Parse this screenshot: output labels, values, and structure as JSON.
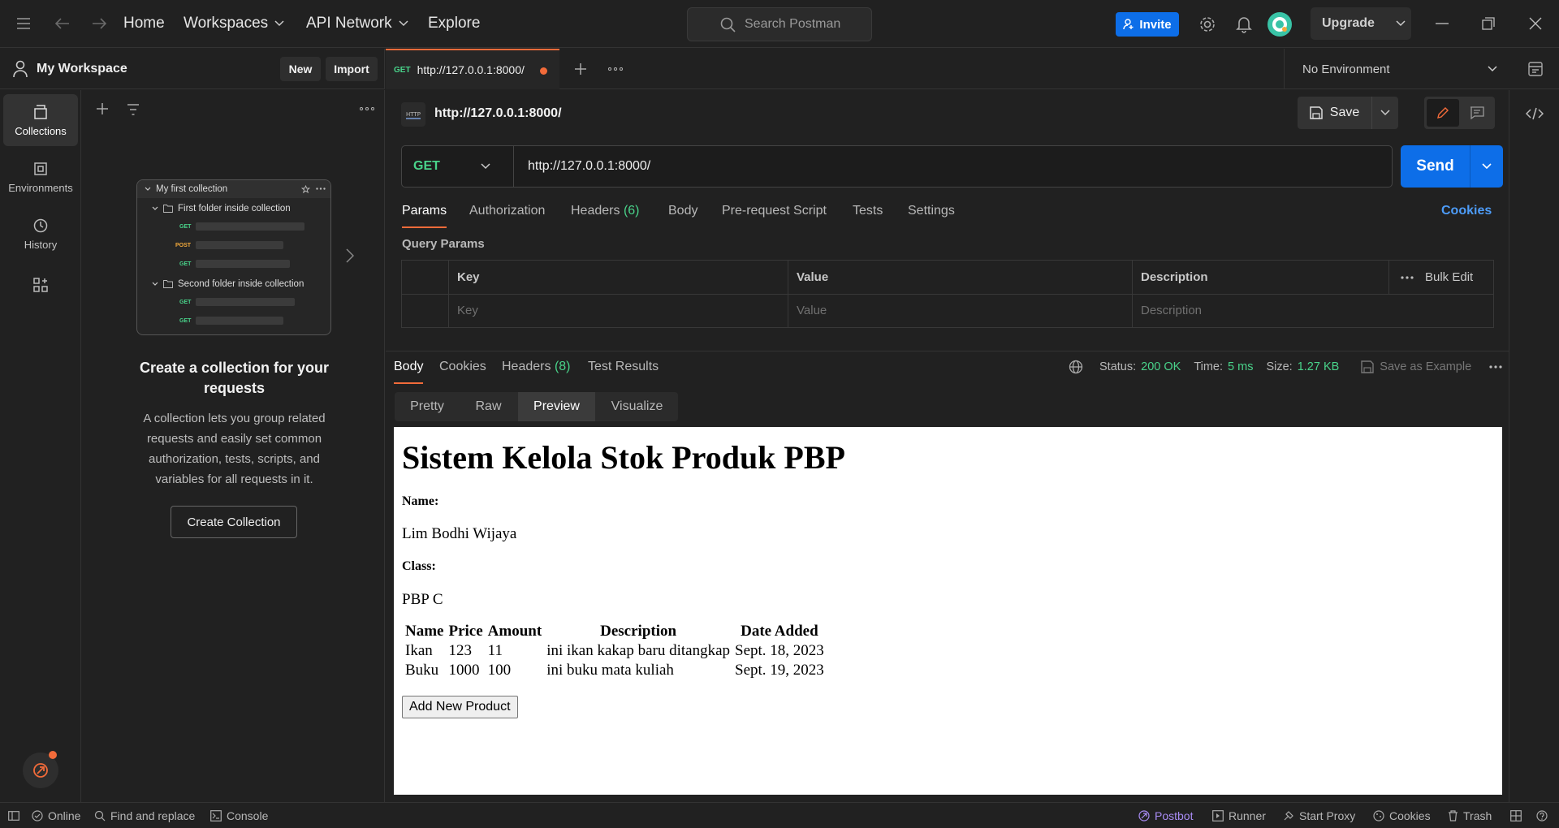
{
  "topbar": {
    "nav": [
      "Home",
      "Workspaces",
      "API Network",
      "Explore"
    ],
    "search_placeholder": "Search Postman",
    "invite_label": "Invite",
    "upgrade_label": "Upgrade"
  },
  "sidebar": {
    "workspace_name": "My Workspace",
    "new_label": "New",
    "import_label": "Import",
    "rail": [
      {
        "label": "Collections",
        "icon": "collections-icon",
        "active": true
      },
      {
        "label": "Environments",
        "icon": "environments-icon",
        "active": false
      },
      {
        "label": "History",
        "icon": "history-icon",
        "active": false
      }
    ],
    "preview": {
      "collection": "My first collection",
      "folder1": "First folder inside collection",
      "folder2": "Second folder inside collection",
      "methods": [
        "GET",
        "POST",
        "GET",
        "GET",
        "GET"
      ]
    },
    "empty_title": "Create a collection for your requests",
    "empty_desc": "A collection lets you group related requests and easily set common authorization, tests, scripts, and variables for all requests in it.",
    "create_label": "Create Collection"
  },
  "tab": {
    "method": "GET",
    "url": "http://127.0.0.1:8000/"
  },
  "environment": "No Environment",
  "request": {
    "title": "http://127.0.0.1:8000/",
    "save_label": "Save",
    "method": "GET",
    "url": "http://127.0.0.1:8000/",
    "send_label": "Send",
    "tabs": [
      {
        "label": "Params",
        "count": ""
      },
      {
        "label": "Authorization",
        "count": ""
      },
      {
        "label": "Headers",
        "count": "(6)"
      },
      {
        "label": "Body",
        "count": ""
      },
      {
        "label": "Pre-request Script",
        "count": ""
      },
      {
        "label": "Tests",
        "count": ""
      },
      {
        "label": "Settings",
        "count": ""
      }
    ],
    "cookies_label": "Cookies",
    "query_params_label": "Query Params",
    "headers": {
      "key": "Key",
      "value": "Value",
      "description": "Description",
      "bulk_edit": "Bulk Edit"
    },
    "placeholders": {
      "key": "Key",
      "value": "Value",
      "description": "Description"
    }
  },
  "response": {
    "tabs": [
      {
        "label": "Body",
        "count": ""
      },
      {
        "label": "Cookies",
        "count": ""
      },
      {
        "label": "Headers",
        "count": "(8)"
      },
      {
        "label": "Test Results",
        "count": ""
      }
    ],
    "status_label": "Status:",
    "status_value": "200 OK",
    "time_label": "Time:",
    "time_value": "5 ms",
    "size_label": "Size:",
    "size_value": "1.27 KB",
    "save_example_label": "Save as Example",
    "views": [
      "Pretty",
      "Raw",
      "Preview",
      "Visualize"
    ],
    "active_view": "Preview"
  },
  "preview_page": {
    "title": "Sistem Kelola Stok Produk PBP",
    "name_label": "Name:",
    "name_value": "Lim Bodhi Wijaya",
    "class_label": "Class:",
    "class_value": "PBP C",
    "table_headers": [
      "Name",
      "Price",
      "Amount",
      "Description",
      "Date Added"
    ],
    "rows": [
      [
        "Ikan",
        "123",
        "11",
        "ini ikan kakap baru ditangkap",
        "Sept. 18, 2023"
      ],
      [
        "Buku",
        "1000",
        "100",
        "ini buku mata kuliah",
        "Sept. 19, 2023"
      ]
    ],
    "add_button": "Add New Product"
  },
  "statusbar": {
    "online": "Online",
    "find_replace": "Find and replace",
    "console": "Console",
    "postbot": "Postbot",
    "runner": "Runner",
    "start_proxy": "Start Proxy",
    "cookies": "Cookies",
    "trash": "Trash"
  },
  "colors": {
    "accent": "#f26b3a",
    "primary": "#0d6ee8",
    "success": "#49d38a",
    "get_method": "#49d38a"
  }
}
